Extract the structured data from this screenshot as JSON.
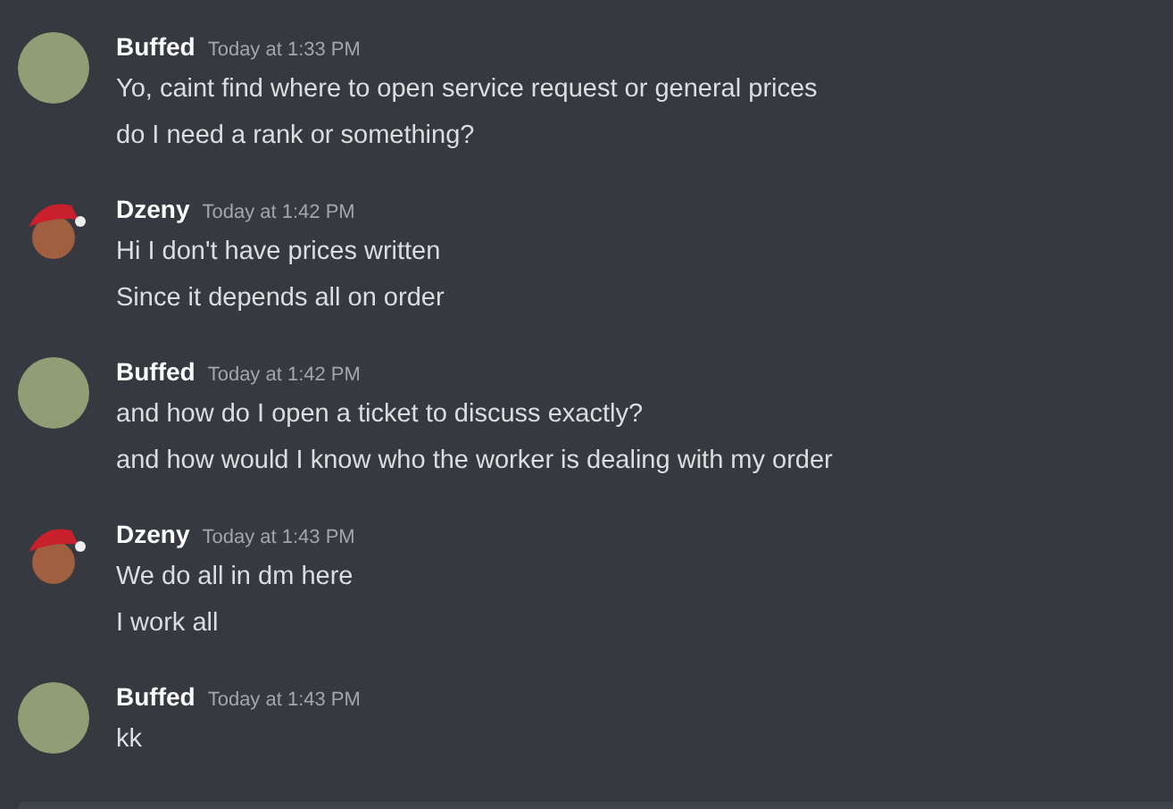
{
  "messages": [
    {
      "author": "Buffed",
      "kind": "pig",
      "time": "Today at 1:33 PM",
      "lines": [
        "Yo, caint find where to open service request or general prices",
        "do I need a rank or something?"
      ]
    },
    {
      "author": "Dzeny",
      "kind": "hat",
      "time": "Today at 1:42 PM",
      "lines": [
        "Hi I don't have prices written",
        "Since it depends all on order"
      ]
    },
    {
      "author": "Buffed",
      "kind": "pig",
      "time": "Today at 1:42 PM",
      "lines": [
        "and how do I open a ticket to discuss exactly?",
        "and how would I know who the worker is dealing with my order"
      ]
    },
    {
      "author": "Dzeny",
      "kind": "hat",
      "time": "Today at 1:43 PM",
      "lines": [
        "We do all in dm here",
        "I work all"
      ]
    },
    {
      "author": "Buffed",
      "kind": "pig",
      "time": "Today at 1:43 PM",
      "lines": [
        "kk"
      ]
    }
  ]
}
